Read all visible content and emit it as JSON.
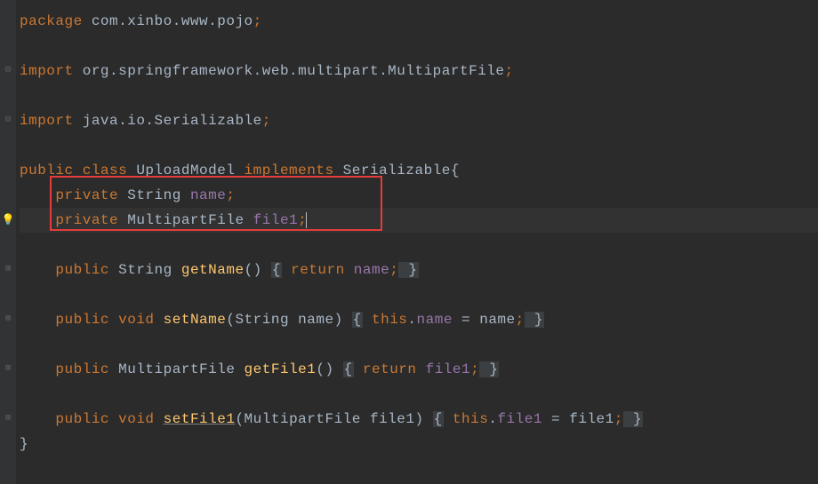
{
  "code": {
    "line1": {
      "kw": "package ",
      "pkg": "com.xinbo.www.pojo",
      "semi": ";"
    },
    "line3": {
      "kw": "import ",
      "pkg": "org.springframework.web.multipart.MultipartFile",
      "semi": ";"
    },
    "line5": {
      "kw": "import ",
      "pkg": "java.io.Serializable",
      "semi": ";"
    },
    "line7": {
      "kw1": "public class ",
      "cls": "UploadModel ",
      "kw2": "implements ",
      "iface": "Serializable",
      "brace": "{"
    },
    "line8": {
      "indent": "    ",
      "kw": "private ",
      "type": "String ",
      "field": "name",
      "semi": ";"
    },
    "line9": {
      "indent": "    ",
      "kw": "private ",
      "type": "MultipartFile ",
      "field": "file1",
      "semi": ";"
    },
    "line11": {
      "indent": "    ",
      "kw1": "public ",
      "type": "String ",
      "method": "getName",
      "params": "() ",
      "ob": "{",
      "ret": " return ",
      "field": "name",
      "semi": ";",
      "cb": " }"
    },
    "line13": {
      "indent": "    ",
      "kw1": "public ",
      "kw2": "void ",
      "method": "setName",
      "params": "(String name) ",
      "ob": "{",
      "this": " this",
      "dot": ".",
      "field": "name",
      "eq": " = name",
      "semi": ";",
      "cb": " }"
    },
    "line15": {
      "indent": "    ",
      "kw1": "public ",
      "type": "MultipartFile ",
      "method": "getFile1",
      "params": "() ",
      "ob": "{",
      "ret": " return ",
      "field": "file1",
      "semi": ";",
      "cb": " }"
    },
    "line17": {
      "indent": "    ",
      "kw1": "public ",
      "kw2": "void ",
      "method": "setFile1",
      "params": "(MultipartFile file1) ",
      "ob": "{",
      "this": " this",
      "dot": ".",
      "field": "file1",
      "eq": " = file1",
      "semi": ";",
      "cb": " }"
    },
    "line18": {
      "brace": "}"
    }
  },
  "icons": {
    "bulb": "💡",
    "fold": "⊞",
    "collapse": "⊟"
  }
}
